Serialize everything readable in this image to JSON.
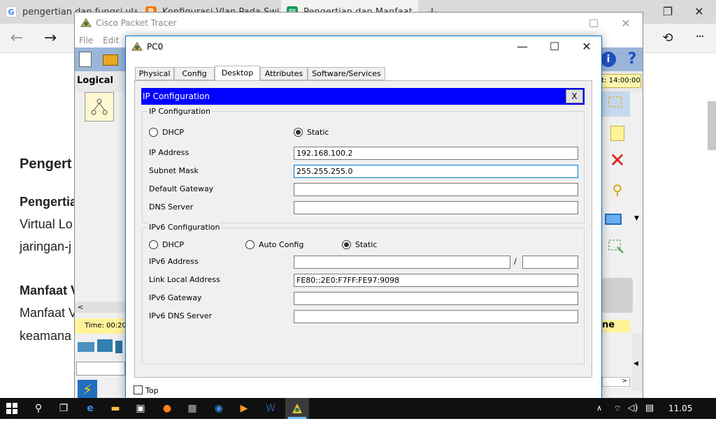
{
  "browser": {
    "tabs": [
      {
        "title": "pengertian dan fungsi vlan",
        "icon": "google-icon",
        "color": "#4285f4"
      },
      {
        "title": "Konfigurasi Vlan Pada Switch",
        "icon": "blogger-icon",
        "color": "#f57d00"
      },
      {
        "title": "Pengertian dan Manfaat",
        "icon": "page-icon",
        "color": "#0f9d58"
      }
    ],
    "new_tab": "+",
    "window_controls": {
      "minimize": "—",
      "restore": "❐",
      "close": "✕"
    },
    "nav": {
      "back": "←",
      "forward": "→"
    },
    "toolbar_right": {
      "share": "⟲",
      "more": "···"
    }
  },
  "article": {
    "heading": "Pengert",
    "sub1": "Pengertia",
    "line1": "Virtual Lo",
    "line2": "jaringan-j",
    "sub2": "Manfaat V",
    "line3": "Manfaat V",
    "line4": "keamana"
  },
  "packet_tracer": {
    "title": "Cisco Packet Tracer",
    "menu": [
      "File",
      "Edit"
    ],
    "logical_label": "Logical",
    "time_label": "Time: 00:20",
    "clock_label": "t: 14:00:00",
    "right_label": "ne",
    "window_controls": {
      "minimize": "—",
      "maximize": "☐",
      "close": "✕"
    }
  },
  "dialog": {
    "title": "PC0",
    "tabs": [
      "Physical",
      "Config",
      "Desktop",
      "Attributes",
      "Software/Services"
    ],
    "active_tab": "Desktop",
    "window_controls": {
      "minimize": "—",
      "maximize": "☐",
      "close": "✕"
    },
    "ip_config": {
      "bar_title": "IP Configuration",
      "close_label": "X",
      "ipv4_group": "IP Configuration",
      "dhcp": "DHCP",
      "static": "Static",
      "ip_label": "IP Address",
      "ip_value": "192.168.100.2",
      "mask_label": "Subnet Mask",
      "mask_value": "255.255.255.0",
      "gateway_label": "Default Gateway",
      "gateway_value": "",
      "dns_label": "DNS Server",
      "dns_value": "",
      "ipv6_group": "IPv6 Configuration",
      "ipv6_dhcp": "DHCP",
      "ipv6_auto": "Auto Config",
      "ipv6_static": "Static",
      "ipv6_addr_label": "IPv6 Address",
      "ipv6_addr_value": "",
      "ipv6_slash": "/",
      "ipv6_prefix_value": "",
      "link_local_label": "Link Local Address",
      "link_local_value": "FE80::2E0:F7FF:FE97:9098",
      "ipv6_gw_label": "IPv6 Gateway",
      "ipv6_gw_value": "",
      "ipv6_dns_label": "IPv6 DNS Server",
      "ipv6_dns_value": ""
    },
    "top_checkbox": "Top"
  },
  "taskbar": {
    "clock": "11.05"
  }
}
